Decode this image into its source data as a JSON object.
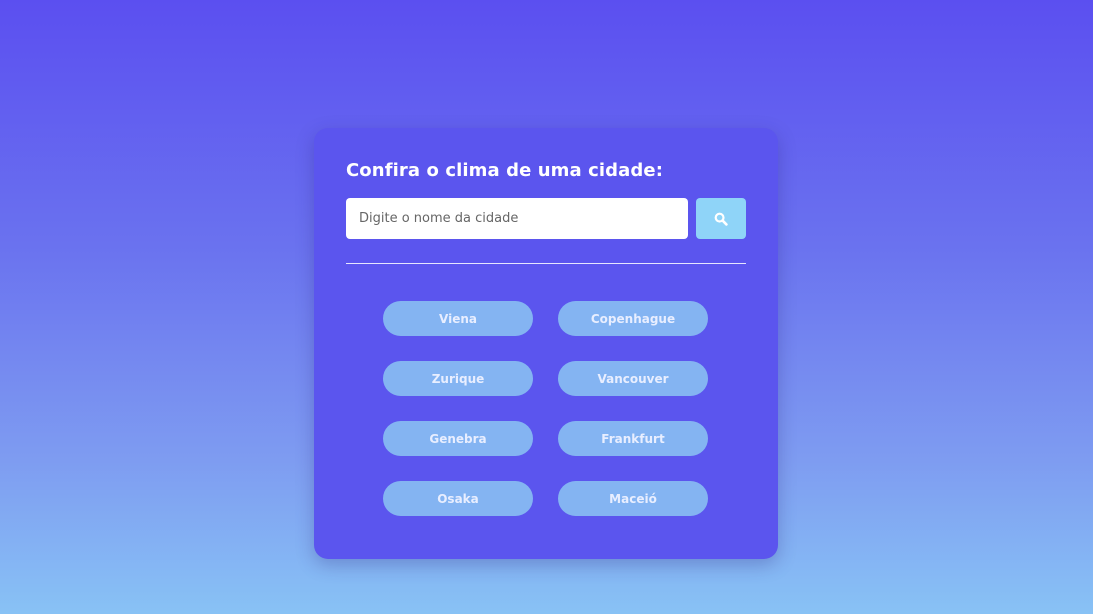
{
  "weather_card": {
    "title": "Confira o clima de uma cidade:",
    "search": {
      "placeholder": "Digite o nome da cidade",
      "value": "",
      "button_icon": "search-icon"
    },
    "cities": [
      "Viena",
      "Copenhague",
      "Zurique",
      "Vancouver",
      "Genebra",
      "Frankfurt",
      "Osaka",
      "Maceió"
    ]
  },
  "colors": {
    "background_top": "#5b4ff0",
    "background_bottom": "#88c2f5",
    "card": "#5b55ee",
    "search_button": "#8fd4f8",
    "city_button": "#84b4f2"
  }
}
